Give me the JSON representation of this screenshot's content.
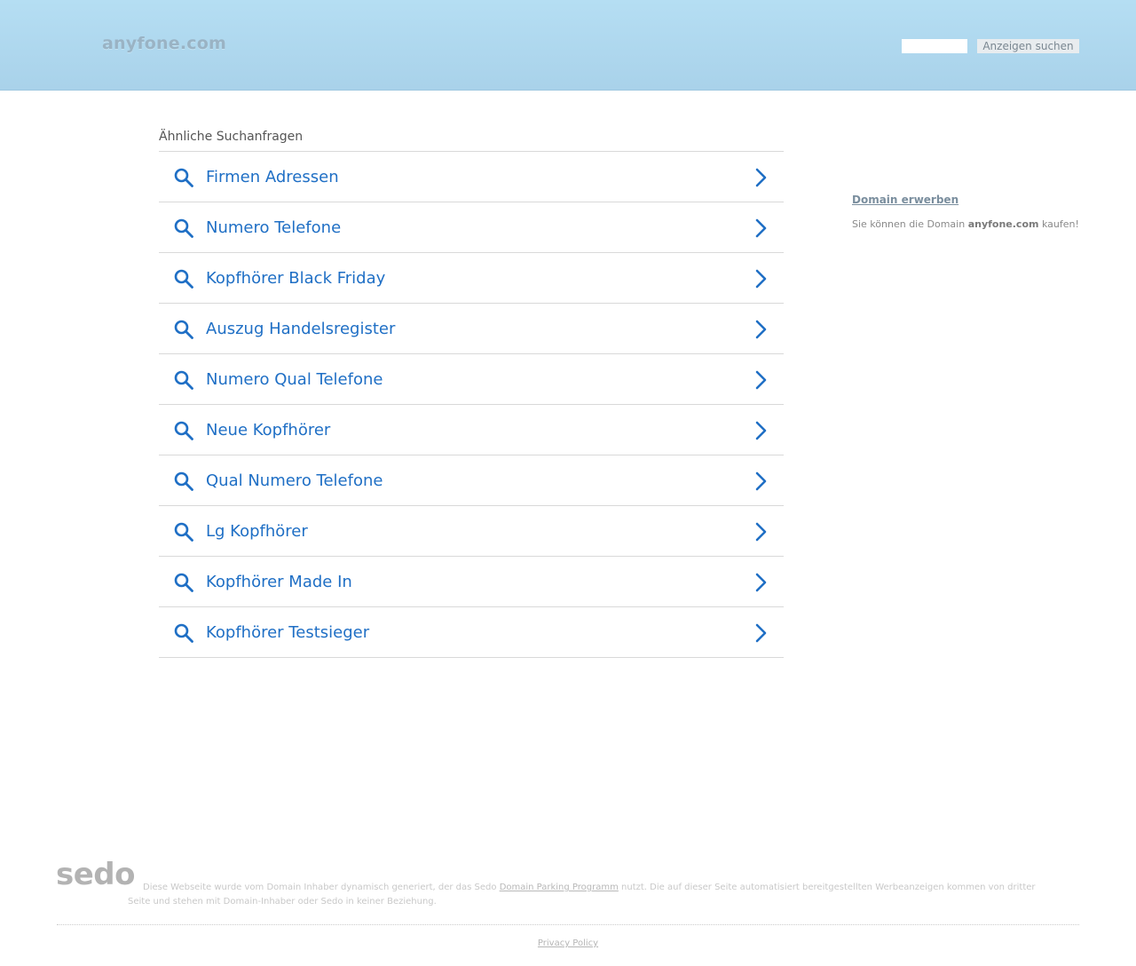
{
  "header": {
    "logo_text": "anyfone.com",
    "search": {
      "value": "",
      "button_label": "Anzeigen suchen"
    }
  },
  "related": {
    "title": "Ähnliche Suchanfragen",
    "items": [
      {
        "label": "Firmen Adressen"
      },
      {
        "label": "Numero Telefone"
      },
      {
        "label": "Kopfhörer Black Friday"
      },
      {
        "label": "Auszug Handelsregister"
      },
      {
        "label": "Numero Qual Telefone"
      },
      {
        "label": "Neue Kopfhörer"
      },
      {
        "label": "Qual Numero Telefone"
      },
      {
        "label": "Lg Kopfhörer"
      },
      {
        "label": "Kopfhörer Made In"
      },
      {
        "label": "Kopfhörer Testsieger"
      }
    ]
  },
  "sidebar": {
    "title": "Domain erwerben",
    "text_before": "Sie können die Domain ",
    "domain": "anyfone.com",
    "text_after": " kaufen!"
  },
  "footer": {
    "sedo_logo": "sedo",
    "disclaimer_before": "Diese Webseite wurde vom Domain Inhaber dynamisch generiert, der das Sedo ",
    "disclaimer_link": "Domain Parking Programm",
    "disclaimer_after": " nutzt. Die auf dieser Seite automatisiert bereitgestellten Werbeanzeigen kommen von dritter Seite und stehen mit Domain-Inhaber oder Sedo in keiner Beziehung.",
    "privacy_label": "Privacy Policy"
  },
  "colors": {
    "link_blue": "#1f6fc5",
    "header_top": "#b5def3",
    "header_bottom": "#a9d2ea"
  },
  "icons": {
    "row_icon": "search-icon",
    "row_arrow": "chevron-right-icon"
  }
}
